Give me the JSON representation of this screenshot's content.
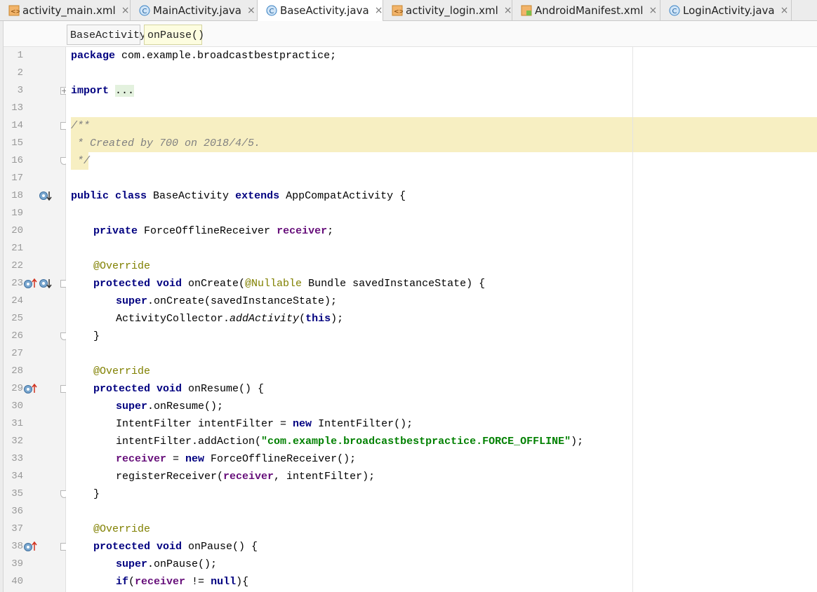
{
  "tabs": [
    {
      "label": "activity_main.xml",
      "icon": "xml-file-icon",
      "active": false
    },
    {
      "label": "MainActivity.java",
      "icon": "java-class-icon",
      "active": false
    },
    {
      "label": "BaseActivity.java",
      "icon": "java-class-icon",
      "active": true
    },
    {
      "label": "activity_login.xml",
      "icon": "xml-file-icon",
      "active": false
    },
    {
      "label": "AndroidManifest.xml",
      "icon": "manifest-file-icon",
      "active": false
    },
    {
      "label": "LoginActivity.java",
      "icon": "java-class-icon",
      "active": false
    }
  ],
  "tab_close_glyph": "×",
  "breadcrumb": {
    "class_name": "BaseActivity",
    "method_name": "onPause()"
  },
  "line_numbers": [
    "1",
    "2",
    "3",
    "13",
    "14",
    "15",
    "16",
    "17",
    "18",
    "19",
    "20",
    "21",
    "22",
    "23",
    "24",
    "25",
    "26",
    "27",
    "28",
    "29",
    "30",
    "31",
    "32",
    "33",
    "34",
    "35",
    "36",
    "37",
    "38",
    "39",
    "40"
  ],
  "code": {
    "l1": {
      "kw": "package",
      "rest": " com.example.broadcastbestpractice;"
    },
    "l3": {
      "kw": "import",
      "fold": "..."
    },
    "l14": "/**",
    "l15": " * Created by 700 on 2018/4/5.",
    "l16": " */",
    "l18": {
      "kw1": "public class",
      "name": " BaseActivity ",
      "kw2": "extends",
      "rest": " AppCompatActivity {"
    },
    "l20": {
      "kw": "private",
      "type": " ForceOfflineReceiver ",
      "field": "receiver",
      "rest": ";"
    },
    "l22": "@Override",
    "l23": {
      "kw": "protected void",
      "name": " onCreate(",
      "ann": "@Nullable",
      "rest": " Bundle savedInstanceState) {"
    },
    "l24": {
      "kw": "super",
      "rest": ".onCreate(savedInstanceState);"
    },
    "l25": {
      "pre": "ActivityCollector.",
      "ital": "addActivity",
      "mid": "(",
      "kw": "this",
      "rest": ");"
    },
    "l26": "}",
    "l28": "@Override",
    "l29": {
      "kw": "protected void",
      "rest": " onResume() {"
    },
    "l30": {
      "kw": "super",
      "rest": ".onResume();"
    },
    "l31": {
      "pre": "IntentFilter intentFilter = ",
      "kw": "new",
      "rest": " IntentFilter();"
    },
    "l32": {
      "pre": "intentFilter.addAction(",
      "str": "\"com.example.broadcastbestpractice.FORCE_OFFLINE\"",
      "rest": ");"
    },
    "l33": {
      "field": "receiver",
      "mid": " = ",
      "kw": "new",
      "rest": " ForceOfflineReceiver();"
    },
    "l34": {
      "pre": "registerReceiver(",
      "field": "receiver",
      "rest": ", intentFilter);"
    },
    "l35": "}",
    "l37": "@Override",
    "l38": {
      "kw": "protected void",
      "rest": " onPause() {"
    },
    "l39": {
      "kw": "super",
      "rest": ".onPause();"
    },
    "l40": {
      "kw": "if",
      "mid": "(",
      "field": "receiver",
      "mid2": " != ",
      "kw2": "null",
      "rest": "){"
    }
  },
  "colors": {
    "keyword": "#000080",
    "annotation": "#808000",
    "comment": "#808080",
    "string": "#008000",
    "field": "#660e7a",
    "comment_highlight": "#f7efc2"
  }
}
